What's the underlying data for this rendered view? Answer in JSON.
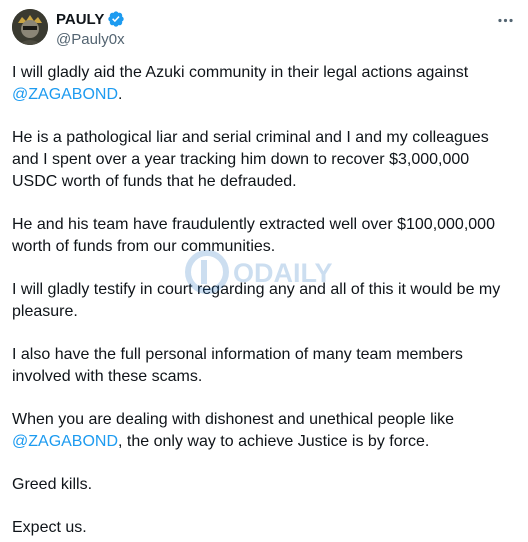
{
  "author": {
    "display_name": "PAULY",
    "handle": "@Pauly0x",
    "verified": true,
    "verified_color": "#1d9bf0"
  },
  "tweet": {
    "p1_text": "I will gladly aid the Azuki community in their legal actions against ",
    "p1_mention": "@ZAGABOND",
    "p1_end": ".",
    "p2": "He is a pathological liar and serial criminal and I and my colleagues and I spent over a year tracking him down to recover $3,000,000 USDC worth of funds that he defrauded.",
    "p3": "He and his team have fraudulently extracted well over $100,000,000 worth of funds from our communities.",
    "p4": "I will gladly testify in court regarding any and all of this it would be my pleasure.",
    "p5": "I also have the full personal information of many team members involved with these scams.",
    "p6_text": "When you are dealing with dishonest and unethical people like ",
    "p6_mention": "@ZAGABOND",
    "p6_end": ", the only way to achieve Justice is by force.",
    "p7": "Greed kills.",
    "p8": "Expect us."
  },
  "watermark": {
    "text": "ODAILY"
  },
  "colors": {
    "text": "#0f1419",
    "secondary": "#536471",
    "mention": "#1d9bf0"
  },
  "icons": {
    "more": "more-options-icon",
    "verified": "verified-badge-icon"
  }
}
